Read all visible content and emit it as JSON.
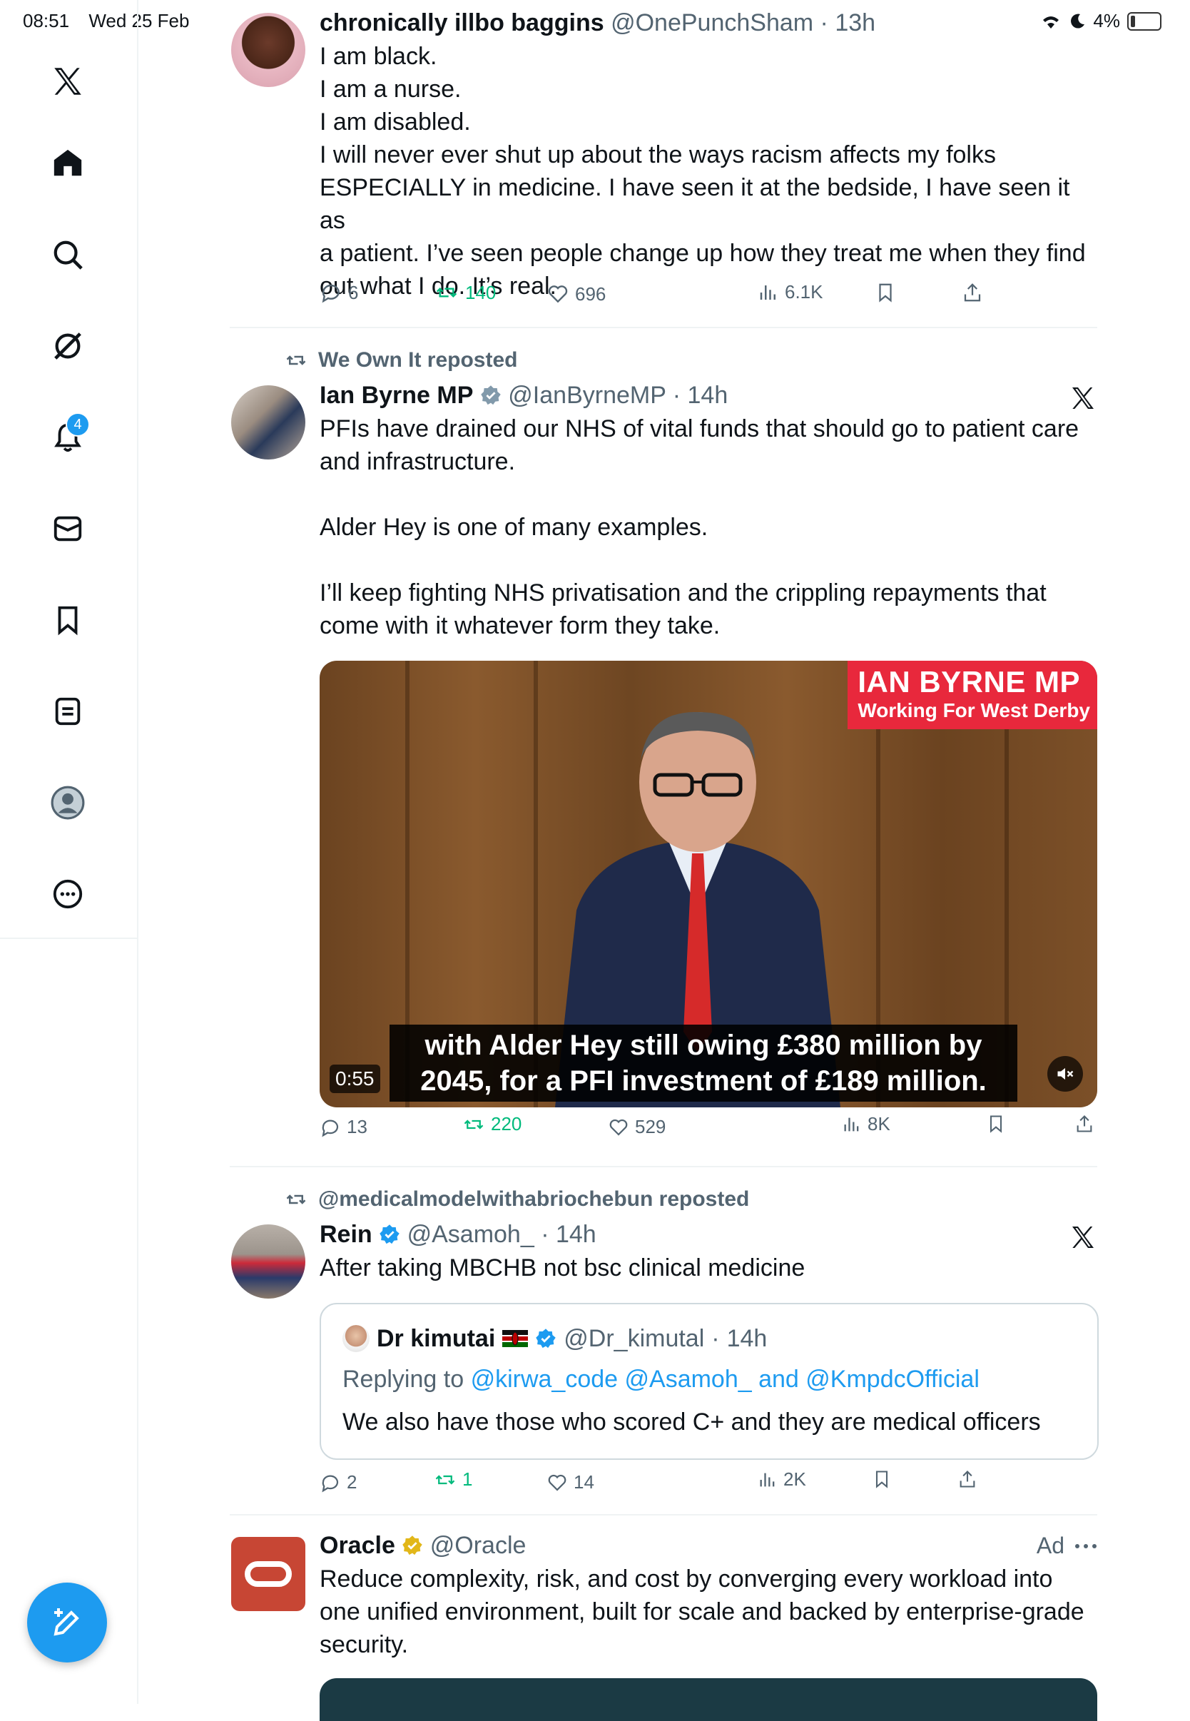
{
  "status_bar": {
    "time": "08:51",
    "date": "Wed 25 Feb",
    "battery": "4%"
  },
  "sidebar": {
    "notifications_badge": "4",
    "items": [
      {
        "name": "x-logo-icon"
      },
      {
        "name": "home-icon"
      },
      {
        "name": "search-icon"
      },
      {
        "name": "grok-icon"
      },
      {
        "name": "notifications-icon"
      },
      {
        "name": "messages-icon"
      },
      {
        "name": "bookmarks-icon"
      },
      {
        "name": "lists-icon"
      },
      {
        "name": "profile-icon"
      },
      {
        "name": "more-icon"
      }
    ]
  },
  "posts": [
    {
      "name": "chronically illbo baggins",
      "handle": "@OnePunchSham",
      "time": "13h",
      "lines": [
        "I am black.",
        "I am a nurse.",
        "I am disabled.",
        "I will never ever shut up about the ways racism affects my folks",
        "ESPECIALLY in medicine. I have seen it at the bedside, I have seen it as",
        "a patient. I’ve seen people change up how they treat me when they find",
        "out what I do. It’s real."
      ],
      "replies": "6",
      "reposts": "140",
      "likes": "696",
      "views": "6.1K"
    },
    {
      "reposted_by": "We Own It reposted",
      "name": "Ian Byrne MP",
      "handle": "@IanByrneMP",
      "time": "14h",
      "lines": [
        "PFIs have drained our NHS of vital funds that should go to patient care",
        "and infrastructure.",
        "",
        "Alder Hey is one of many examples.",
        "",
        "I’ll keep fighting NHS privatisation and the crippling repayments that",
        "come with it whatever form they take."
      ],
      "video": {
        "brand_title": "IAN BYRNE MP",
        "brand_subtitle": "Working For West Derby",
        "caption_line1": "with Alder Hey still owing £380 million by",
        "caption_line2": "2045, for a PFI investment of £189 million.",
        "duration": "0:55"
      },
      "replies": "13",
      "reposts": "220",
      "likes": "529",
      "views": "8K"
    },
    {
      "reposted_by": "@medicalmodelwithabriochebun reposted",
      "name": "Rein",
      "handle": "@Asamoh_",
      "time": "14h",
      "text": "After taking MBCHB not bsc clinical medicine",
      "quote": {
        "name": "Dr kimutai",
        "handle": "@Dr_kimutal",
        "time": "14h",
        "replying_prefix": "Replying to",
        "replying_to": "@kirwa_code @Asamoh_ and @KmpdcOfficial",
        "text": "We also have those who scored C+ and they are medical officers"
      },
      "replies": "2",
      "reposts": "1",
      "likes": "14",
      "views": "2K"
    },
    {
      "name": "Oracle",
      "handle": "@Oracle",
      "ad_label": "Ad",
      "lines": [
        "Reduce complexity, risk, and cost by converging every workload into",
        "one unified environment, built for scale and backed by enterprise-grade",
        "security."
      ]
    }
  ],
  "colors": {
    "accent": "#1d9bf0",
    "repost_green": "#00ba7c",
    "muted": "#536471",
    "oracle_red": "#c74634",
    "brand_red": "#e8283c"
  }
}
